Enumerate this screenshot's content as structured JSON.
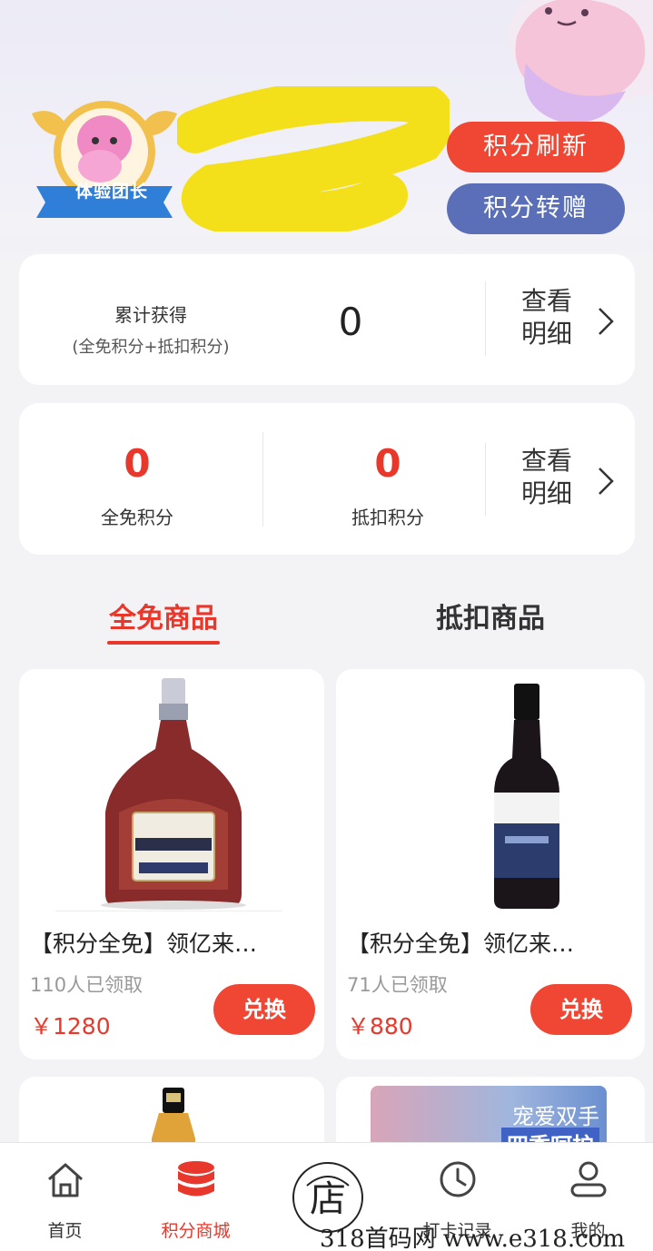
{
  "profile": {
    "badge_label": "体验团长"
  },
  "actions": {
    "refresh_label": "积分刷新",
    "transfer_label": "积分转赠"
  },
  "total": {
    "label": "累计获得",
    "sublabel": "(全免积分+抵扣积分)",
    "value": "0",
    "detail_label": "查看明细"
  },
  "points": {
    "free_value": "0",
    "free_label": "全免积分",
    "deduct_value": "0",
    "deduct_label": "抵扣积分",
    "detail_label": "查看明细"
  },
  "tabs": [
    {
      "label": "全免商品",
      "active": true
    },
    {
      "label": "抵扣商品",
      "active": false
    }
  ],
  "products": [
    {
      "title": "【积分全免】领亿来…",
      "claimed": "110人已领取",
      "price": "￥1280",
      "button": "兑换",
      "image": "brandy-bottle"
    },
    {
      "title": "【积分全免】领亿来…",
      "claimed": "71人已领取",
      "price": "￥880",
      "button": "兑换",
      "image": "red-wine-bottle"
    }
  ],
  "promo": {
    "line1": "宠爱双手",
    "line2": "四季呵护"
  },
  "nav": [
    {
      "label": "首页",
      "icon": "home-icon",
      "active": false
    },
    {
      "label": "积分商城",
      "icon": "database-icon",
      "active": true
    },
    {
      "label": "",
      "icon": "shop-icon",
      "active": false
    },
    {
      "label": "打卡记录",
      "icon": "clock-icon",
      "active": false
    },
    {
      "label": "我的",
      "icon": "user-icon",
      "active": false
    }
  ],
  "watermark": {
    "text": "318首码网 www.e318.com",
    "logo_char": "店"
  },
  "colors": {
    "accent": "#e8382b",
    "refresh_button": "#ef4733",
    "transfer_button": "#5a6fb8"
  }
}
